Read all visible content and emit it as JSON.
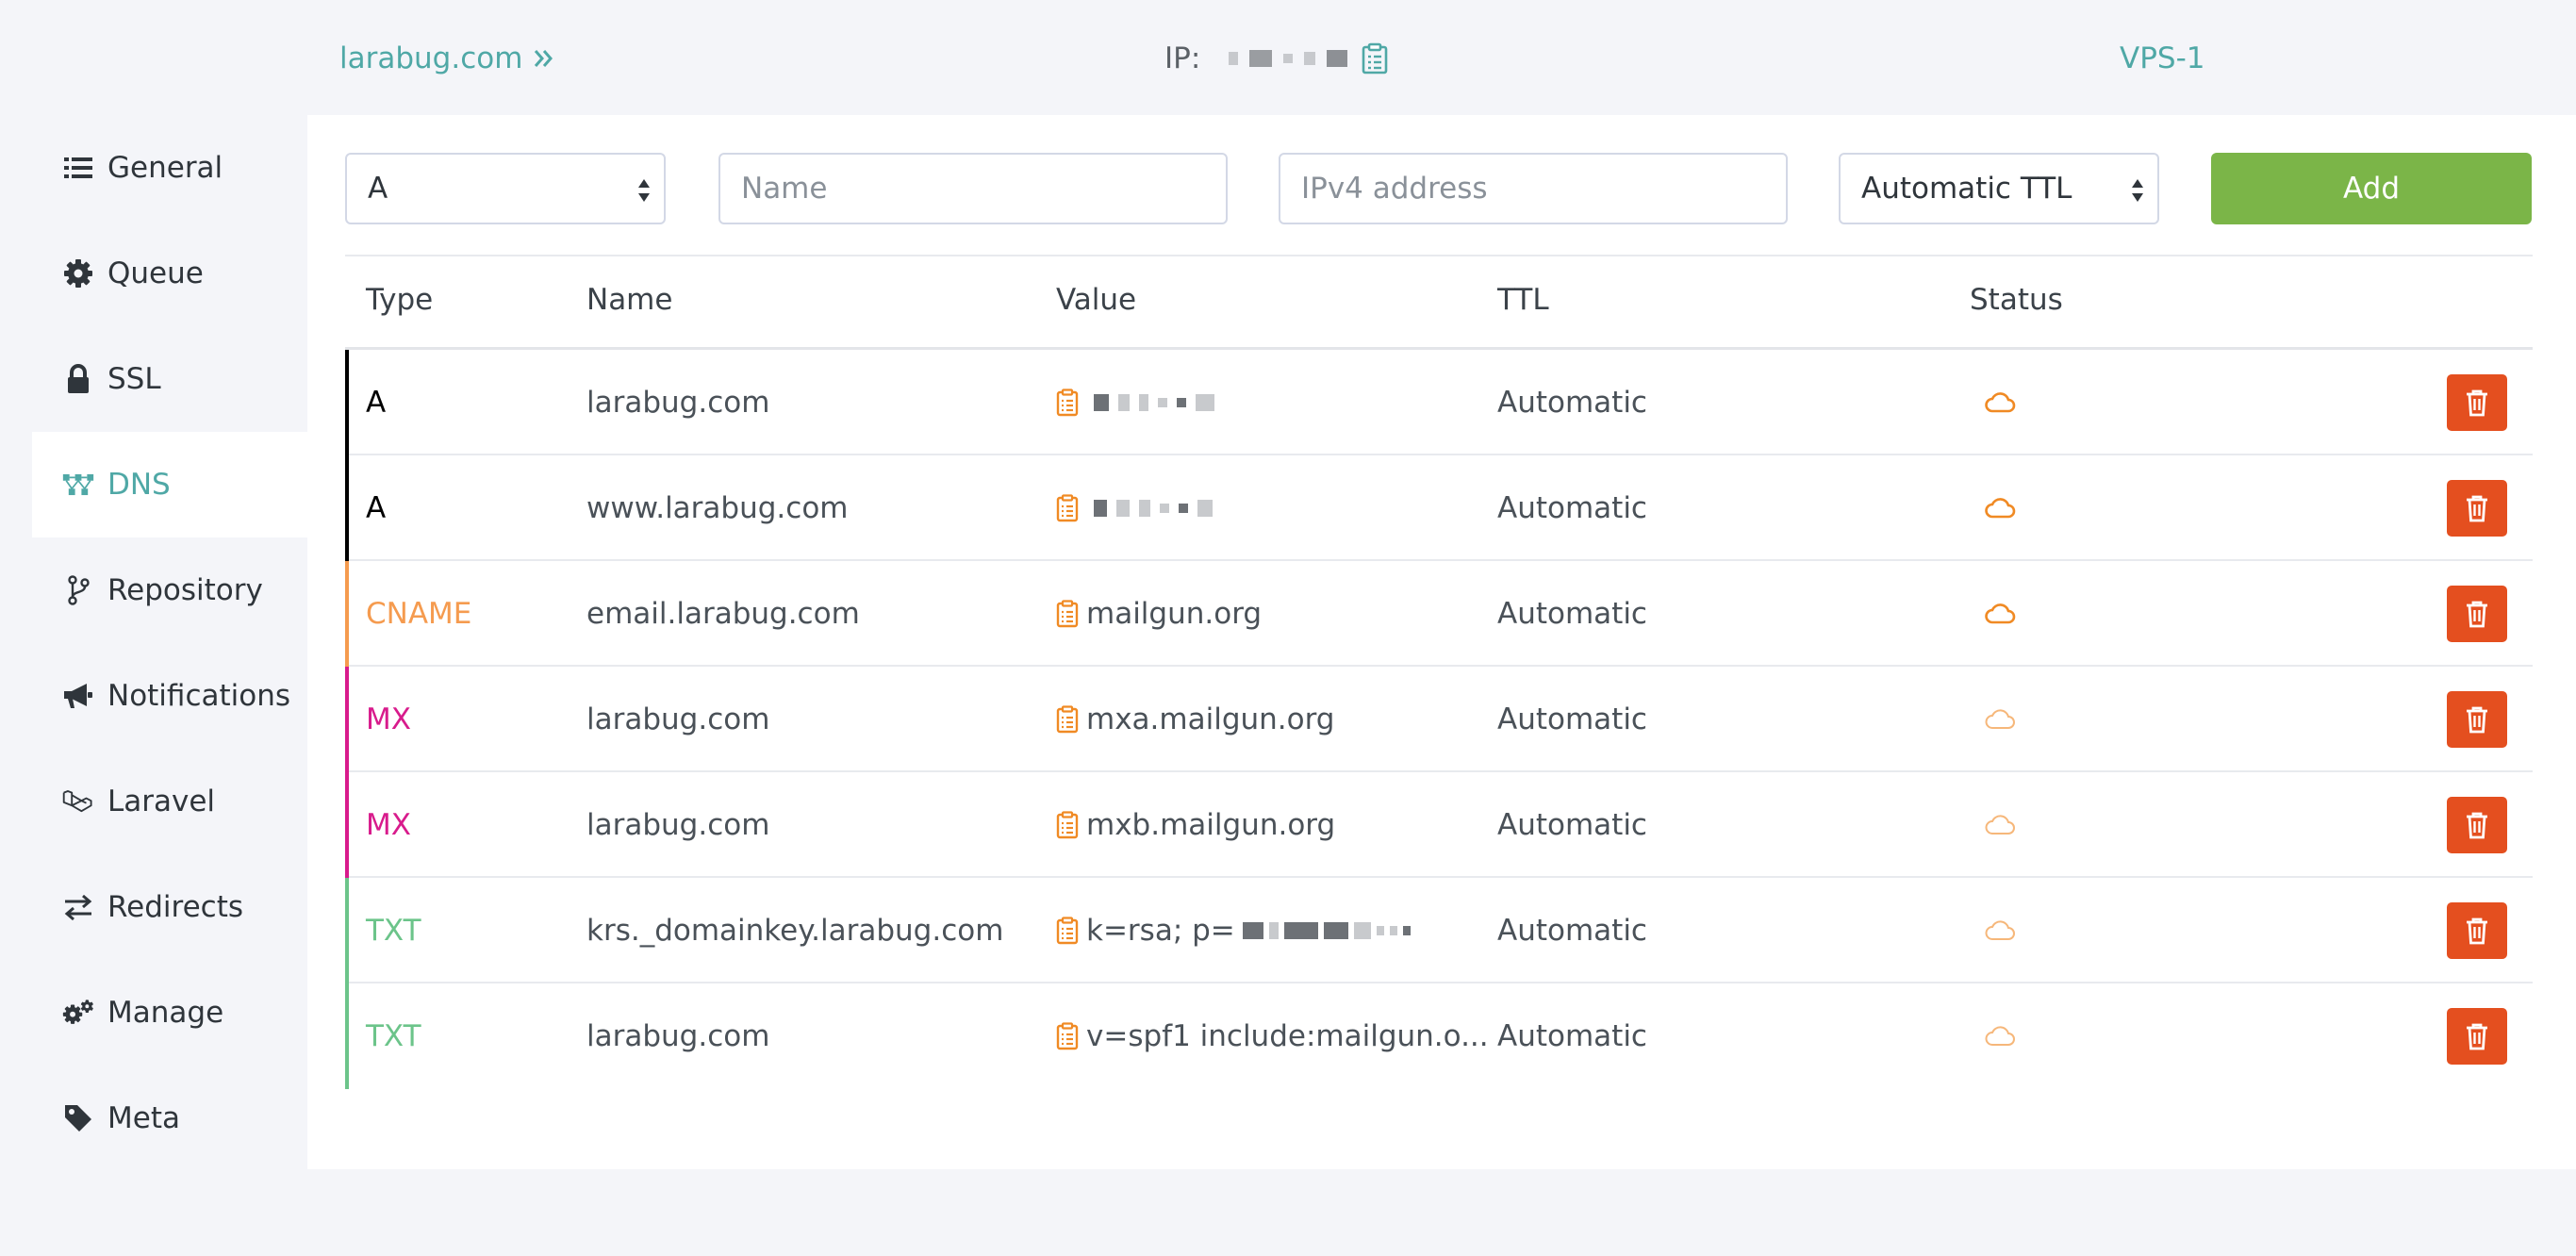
{
  "header": {
    "domain": "larabug.com",
    "ip_label": "IP:",
    "server_name": "VPS-1"
  },
  "sidebar": {
    "items": [
      {
        "label": "General",
        "icon": "list-icon"
      },
      {
        "label": "Queue",
        "icon": "gear-icon"
      },
      {
        "label": "SSL",
        "icon": "lock-icon"
      },
      {
        "label": "DNS",
        "icon": "network-icon",
        "active": true
      },
      {
        "label": "Repository",
        "icon": "git-branch-icon"
      },
      {
        "label": "Notifications",
        "icon": "megaphone-icon"
      },
      {
        "label": "Laravel",
        "icon": "laravel-icon"
      },
      {
        "label": "Redirects",
        "icon": "exchange-icon"
      },
      {
        "label": "Manage",
        "icon": "gears-icon"
      },
      {
        "label": "Meta",
        "icon": "tag-icon"
      }
    ]
  },
  "form": {
    "type_value": "A",
    "name_placeholder": "Name",
    "value_placeholder": "IPv4 address",
    "ttl_value": "Automatic TTL",
    "add_label": "Add"
  },
  "table": {
    "columns": [
      "Type",
      "Name",
      "Value",
      "TTL",
      "Status"
    ],
    "rows": [
      {
        "type": "A",
        "name": "larabug.com",
        "value": "",
        "value_masked": true,
        "ttl": "Automatic",
        "status": "proxied"
      },
      {
        "type": "A",
        "name": "www.larabug.com",
        "value": "",
        "value_masked": true,
        "ttl": "Automatic",
        "status": "proxied"
      },
      {
        "type": "CNAME",
        "name": "email.larabug.com",
        "value": "mailgun.org",
        "ttl": "Automatic",
        "status": "proxied"
      },
      {
        "type": "MX",
        "name": "larabug.com",
        "value": "mxa.mailgun.org",
        "ttl": "Automatic",
        "status": "dns-only"
      },
      {
        "type": "MX",
        "name": "larabug.com",
        "value": "mxb.mailgun.org",
        "ttl": "Automatic",
        "status": "dns-only"
      },
      {
        "type": "TXT",
        "name": "krs._domainkey.larabug.com",
        "value": "k=rsa; p=",
        "value_masked": true,
        "ttl": "Automatic",
        "status": "dns-only"
      },
      {
        "type": "TXT",
        "name": "larabug.com",
        "value": "v=spf1 include:mailgun.o...",
        "ttl": "Automatic",
        "status": "dns-only"
      }
    ]
  },
  "colors": {
    "accent": "#4fa8a6",
    "add": "#7bb548",
    "delete": "#e44f1f",
    "icon_orange": "#f08a24",
    "type_A": "#000000",
    "type_CNAME": "#f59b4f",
    "type_MX": "#d81b8c",
    "type_TXT": "#6cc48a"
  }
}
